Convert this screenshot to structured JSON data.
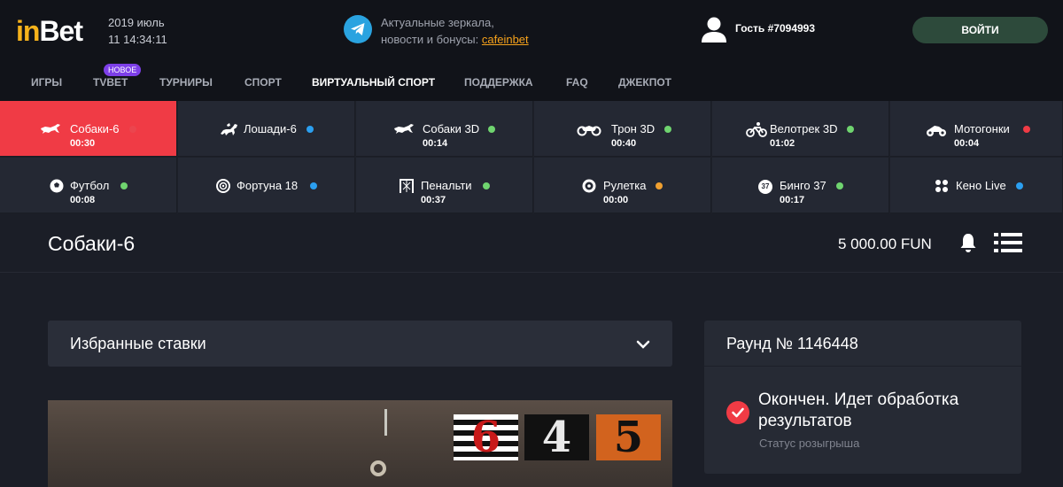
{
  "header": {
    "logo_i": "in",
    "logo_rest": "Bet",
    "date": "2019 июль",
    "time": "11 14:34:11",
    "telegram_line1": "Актуальные зеркала,",
    "telegram_line2_prefix": "новости и бонусы: ",
    "telegram_link": "cafeinbet",
    "guest_label": "Гость #7094993",
    "login_label": "ВОЙТИ"
  },
  "nav": {
    "items": [
      {
        "label": "ИГРЫ"
      },
      {
        "label": "TVBET"
      },
      {
        "label": "ТУРНИРЫ"
      },
      {
        "label": "СПОРТ"
      },
      {
        "label": "ВИРТУАЛЬНЫЙ СПОРТ"
      },
      {
        "label": "ПОДДЕРЖКА"
      },
      {
        "label": "FAQ"
      },
      {
        "label": "ДЖЕКПОТ"
      }
    ],
    "new_badge": "НОВОЕ"
  },
  "tiles": [
    {
      "name": "Собаки-6",
      "time": "00:30",
      "dot": "#f03b45",
      "icon": "greyhound-icon"
    },
    {
      "name": "Лошади-6",
      "time": "",
      "dot": "#2b9ff0",
      "icon": "horse-icon"
    },
    {
      "name": "Собаки 3D",
      "time": "00:14",
      "dot": "#6fd46f",
      "icon": "greyhound-icon"
    },
    {
      "name": "Трон 3D",
      "time": "00:40",
      "dot": "#6fd46f",
      "icon": "tron-bike-icon"
    },
    {
      "name": "Велотрек 3D",
      "time": "01:02",
      "dot": "#6fd46f",
      "icon": "cyclist-icon"
    },
    {
      "name": "Мотогонки",
      "time": "00:04",
      "dot": "#f03b45",
      "icon": "motorbike-icon"
    },
    {
      "name": "Футбол",
      "time": "00:08",
      "dot": "#6fd46f",
      "icon": "soccer-ball-icon"
    },
    {
      "name": "Фортуна 18",
      "time": "",
      "dot": "#2b9ff0",
      "icon": "fortune-wheel-icon"
    },
    {
      "name": "Пенальти",
      "time": "00:37",
      "dot": "#6fd46f",
      "icon": "goal-net-icon"
    },
    {
      "name": "Рулетка",
      "time": "00:00",
      "dot": "#f0a030",
      "icon": "roulette-icon"
    },
    {
      "name": "Бинго 37",
      "time": "00:17",
      "dot": "#6fd46f",
      "icon": "bingo-ball-icon"
    },
    {
      "name": "Кено Live",
      "time": "",
      "dot": "#2b9ff0",
      "icon": "keno-icon"
    }
  ],
  "bingo_icon_text": "37",
  "main": {
    "title": "Собаки-6",
    "balance": "5 000.00 FUN",
    "favorites_label": "Избранные ставки",
    "video_numbers": [
      "6",
      "4",
      "5"
    ]
  },
  "round": {
    "title": "Раунд № 1146448",
    "status": "Окончен. Идет обработка результатов",
    "status_label": "Статус розыгрыша"
  },
  "colors": {
    "accent_red": "#f03b45",
    "login_green": "#2d4a3b",
    "logo_yellow": "#f6b21b",
    "link_orange": "#f6a21b"
  }
}
